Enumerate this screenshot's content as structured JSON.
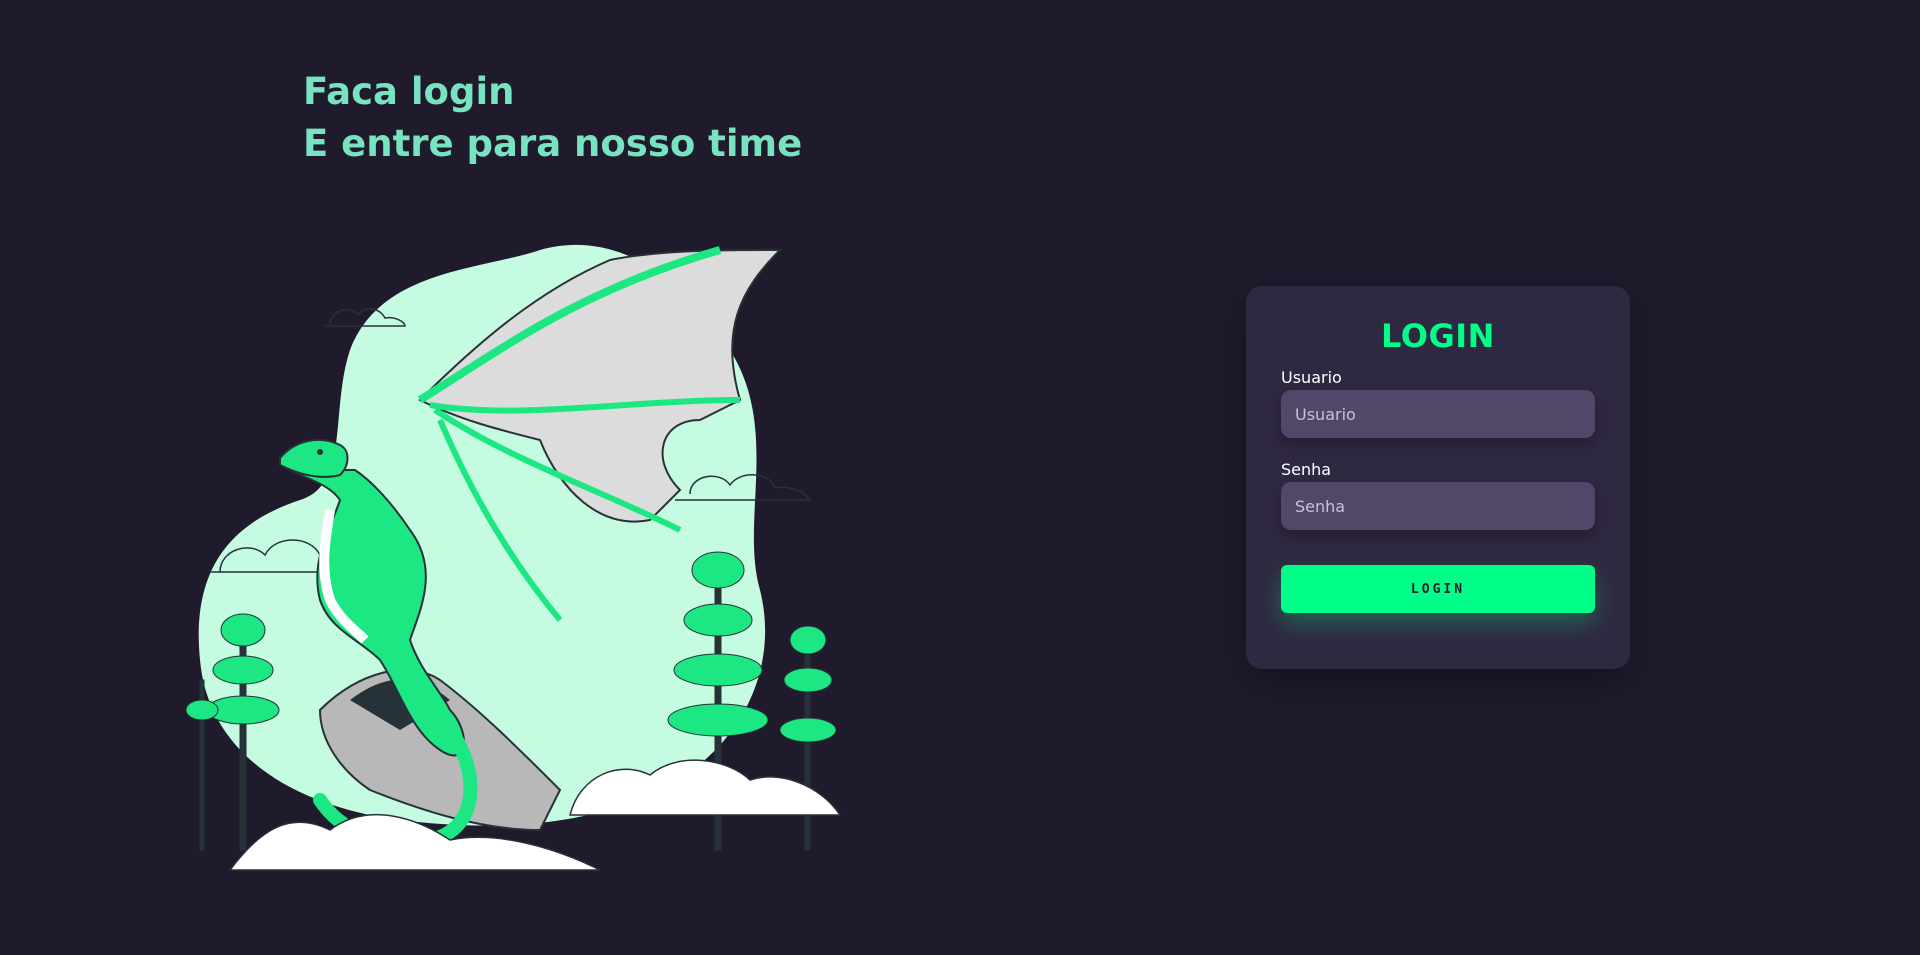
{
  "headline": {
    "line1": "Faca login",
    "line2": "E entre para nosso time"
  },
  "illustration": {
    "icon": "dragon-illustration",
    "colors": {
      "blob": "#c5fbe0",
      "dragon": "#1de783",
      "wing": "#dcdcdc",
      "dark": "#263238",
      "snow": "#ffffff"
    }
  },
  "login": {
    "title": "LOGIN",
    "username_label": "Usuario",
    "username_placeholder": "Usuario",
    "password_label": "Senha",
    "password_placeholder": "Senha",
    "button_label": "LOGIN"
  },
  "colors": {
    "background": "#1f1b2d",
    "card": "#2f2841",
    "input": "#514869",
    "accent": "#00ff88",
    "headline": "#77e3c1"
  }
}
